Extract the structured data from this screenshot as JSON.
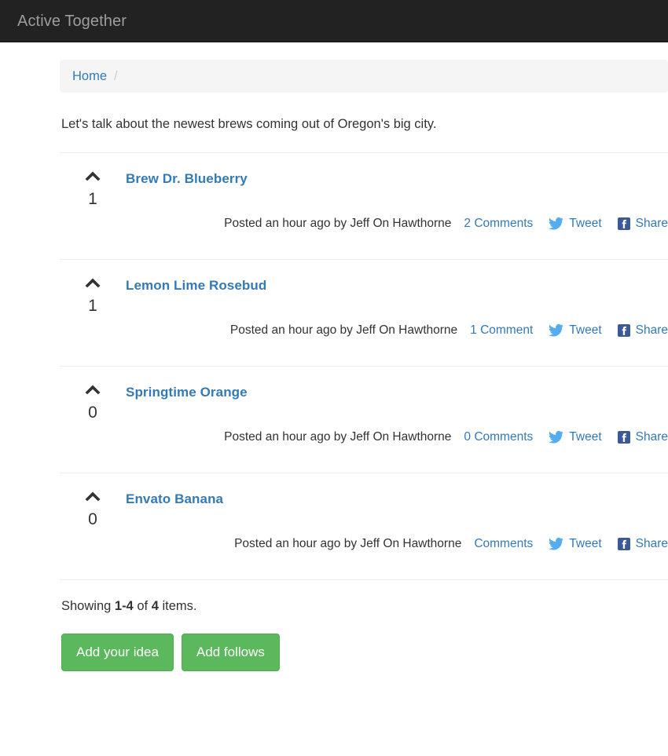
{
  "navbar": {
    "brand": "Active Together"
  },
  "breadcrumb": {
    "home_label": "Home",
    "separator": "/"
  },
  "intro": {
    "text": "Let's talk about the newest brews coming out of Oregon's big city."
  },
  "list": {
    "items": [
      {
        "vote_count": "1",
        "title": "Brew Dr. Blueberry",
        "posted": "Posted an hour ago by Jeff On Hawthorne",
        "comments_label": "2 Comments",
        "tweet_label": "Tweet",
        "share_label": "Share"
      },
      {
        "vote_count": "1",
        "title": "Lemon Lime Rosebud",
        "posted": "Posted an hour ago by Jeff On Hawthorne",
        "comments_label": "1 Comment",
        "tweet_label": "Tweet",
        "share_label": "Share"
      },
      {
        "vote_count": "0",
        "title": "Springtime Orange",
        "posted": "Posted an hour ago by Jeff On Hawthorne",
        "comments_label": "0 Comments",
        "tweet_label": "Tweet",
        "share_label": "Share"
      },
      {
        "vote_count": "0",
        "title": "Envato Banana",
        "posted": "Posted an hour ago by Jeff On Hawthorne",
        "comments_label": "Comments",
        "tweet_label": "Tweet",
        "share_label": "Share"
      }
    ]
  },
  "footer": {
    "summary_prefix": "Showing ",
    "summary_range": "1-4",
    "summary_middle": " of ",
    "summary_total": "4",
    "summary_suffix": " items.",
    "add_idea_label": "Add your idea",
    "add_follows_label": "Add follows"
  },
  "colors": {
    "navbar_bg": "#222222",
    "brand_text": "#9d9d9d",
    "link_blue": "#337ab7",
    "breadcrumb_bg": "#f5f5f5",
    "button_green": "#5cb85c",
    "twitter_blue": "#55acee",
    "facebook_blue": "#3b5998",
    "divider": "#eeeeee",
    "body_text": "#333333"
  }
}
